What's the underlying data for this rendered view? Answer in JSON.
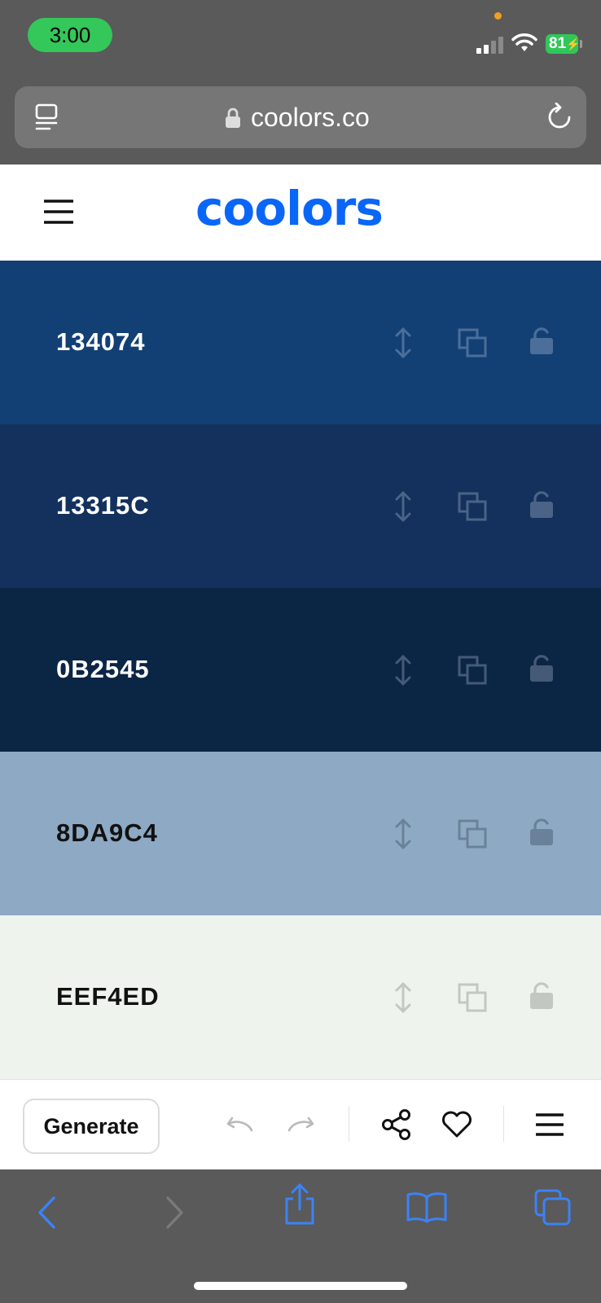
{
  "status_bar": {
    "time": "3:00",
    "battery": "81",
    "colors": {
      "time_pill": "#34c759",
      "battery": "#30c759",
      "dot": "#f0a020"
    }
  },
  "browser": {
    "url": "coolors.co",
    "icons": [
      "reader-icon",
      "lock-icon",
      "reload-icon"
    ]
  },
  "app": {
    "logo": "coolors",
    "brand_color": "#0a66f7",
    "menu_icon": "hamburger-menu-icon"
  },
  "palette": [
    {
      "hex": "134074",
      "bg": "#134074",
      "text": "#ffffff",
      "icon_color": "#4b6e9a"
    },
    {
      "hex": "13315C",
      "bg": "#13315C",
      "text": "#ffffff",
      "icon_color": "#4a6386"
    },
    {
      "hex": "0B2545",
      "bg": "#0B2545",
      "text": "#ffffff",
      "icon_color": "#455a76"
    },
    {
      "hex": "8DA9C4",
      "bg": "#8DA9C4",
      "text": "#111111",
      "icon_color": "#6a8299"
    },
    {
      "hex": "EEF4ED",
      "bg": "#EEF4ED",
      "text": "#111111",
      "icon_color": "#c2c7c2"
    }
  ],
  "swatch_tools": [
    "drag-icon",
    "copy-icon",
    "unlock-icon"
  ],
  "toolbar": {
    "generate_label": "Generate",
    "icons": [
      "undo-icon",
      "redo-icon",
      "share-icon",
      "heart-icon",
      "menu-icon"
    ]
  },
  "safari_nav": {
    "icons": [
      "back-icon",
      "forward-icon",
      "share-icon",
      "bookmarks-icon",
      "tabs-icon"
    ],
    "accent": "#3b82f6"
  }
}
